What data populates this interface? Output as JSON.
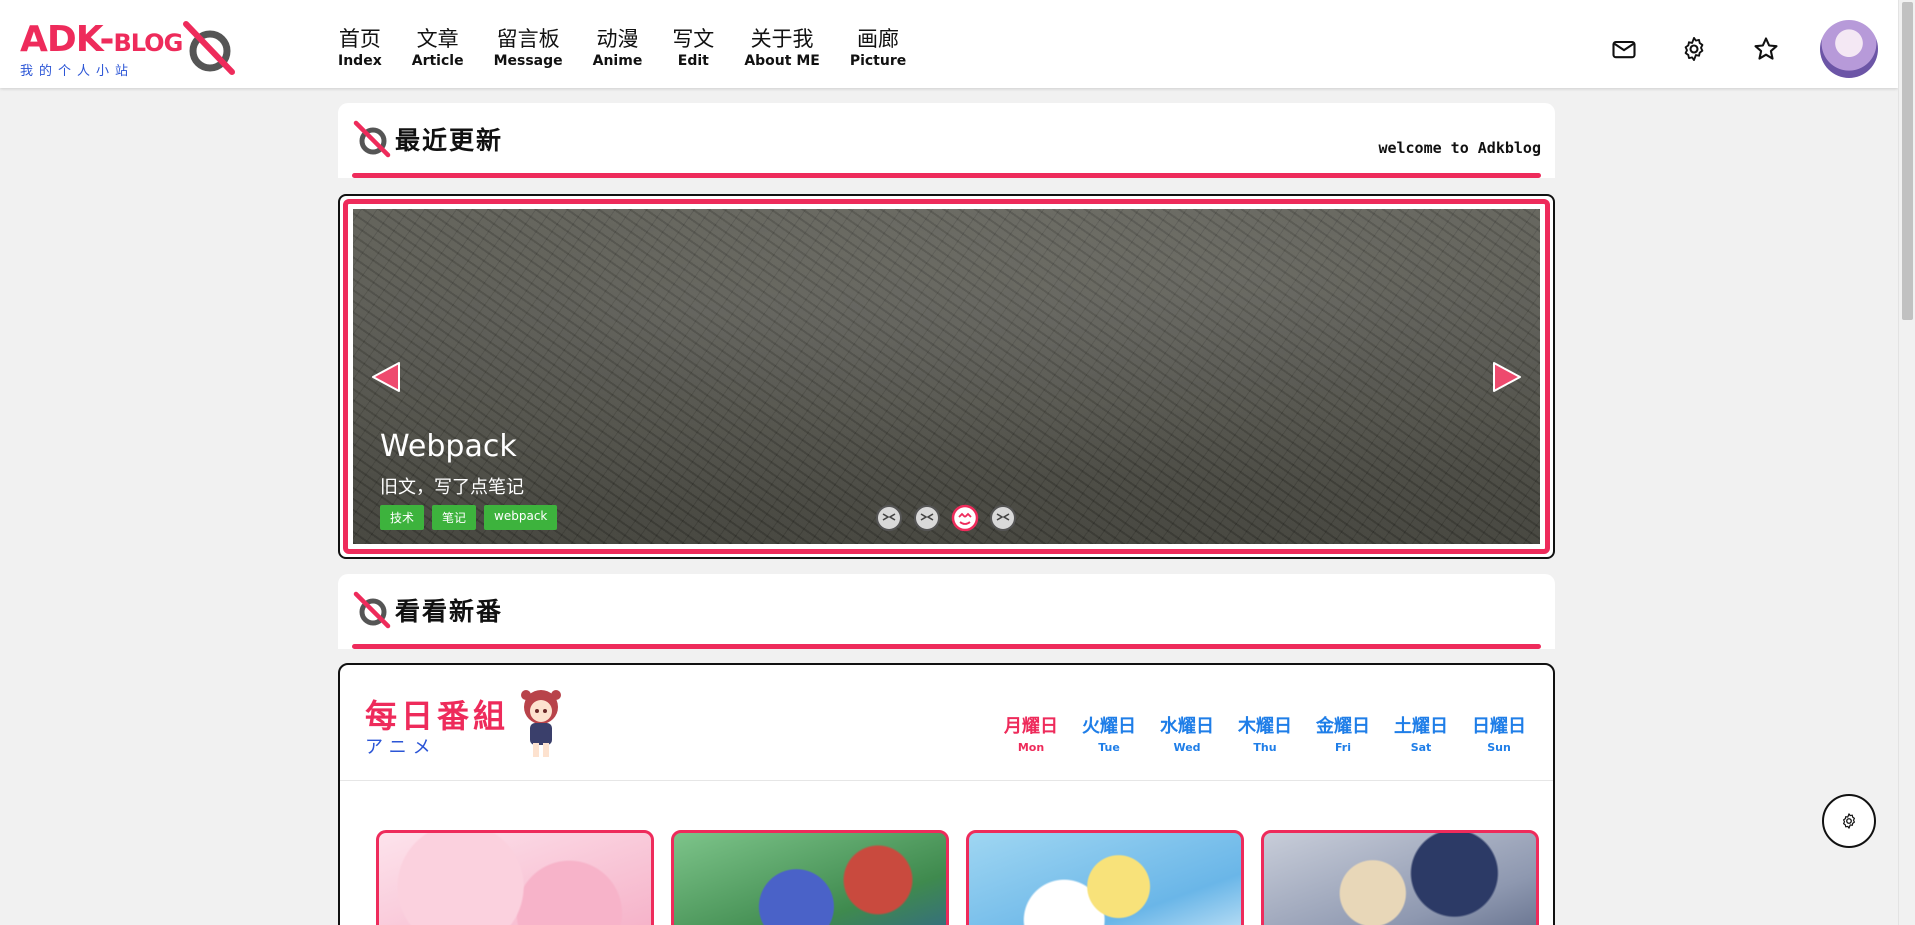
{
  "logo": {
    "title_main": "ADK-",
    "title_blog": "BLOG",
    "subtitle": "我的个人小站"
  },
  "nav": [
    {
      "cn": "首页",
      "en": "Index"
    },
    {
      "cn": "文章",
      "en": "Article"
    },
    {
      "cn": "留言板",
      "en": "Message"
    },
    {
      "cn": "动漫",
      "en": "Anime"
    },
    {
      "cn": "写文",
      "en": "Edit"
    },
    {
      "cn": "关于我",
      "en": "About ME"
    },
    {
      "cn": "画廊",
      "en": "Picture"
    }
  ],
  "header_icons": [
    "mail-icon",
    "gear-icon",
    "star-icon"
  ],
  "recent": {
    "title": "最近更新",
    "welcome": "welcome to Adkblog"
  },
  "carousel": {
    "title": "Webpack",
    "desc": "旧文，写了点笔记",
    "tags": [
      "技术",
      "笔记",
      "webpack"
    ],
    "dot_count": 4,
    "active_dot": 3
  },
  "anime_section": {
    "title": "看看新番"
  },
  "schedule": {
    "title": "每日番組",
    "subtitle": "アニメ",
    "days": [
      {
        "cn": "月耀日",
        "en": "Mon"
      },
      {
        "cn": "火耀日",
        "en": "Tue"
      },
      {
        "cn": "水耀日",
        "en": "Wed"
      },
      {
        "cn": "木耀日",
        "en": "Thu"
      },
      {
        "cn": "金耀日",
        "en": "Fri"
      },
      {
        "cn": "土耀日",
        "en": "Sat"
      },
      {
        "cn": "日耀日",
        "en": "Sun"
      }
    ],
    "active_day": 0
  },
  "colors": {
    "accent": "#ee2b5b",
    "blue": "#1f7ee8",
    "tag_green": "#3db33d"
  }
}
